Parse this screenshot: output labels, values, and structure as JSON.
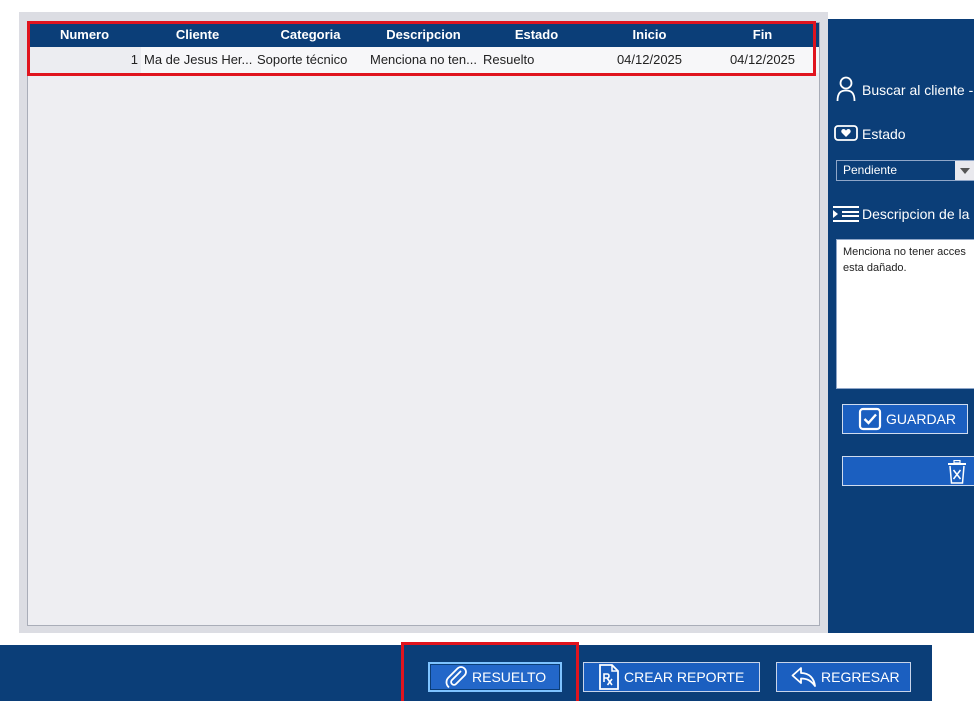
{
  "grid": {
    "columns": [
      "Numero",
      "Cliente",
      "Categoria",
      "Descripcion",
      "Estado",
      "Inicio",
      "Fin"
    ],
    "rows": [
      {
        "numero": "1",
        "cliente": "Ma de Jesus Her...",
        "categoria": "Soporte técnico",
        "descripcion": "Menciona no ten...",
        "estado": "Resuelto",
        "inicio": "04/12/2025",
        "fin": "04/12/2025"
      }
    ]
  },
  "side_panel": {
    "buscar_label": "Buscar al cliente -",
    "estado_label": "Estado",
    "estado_value": "Pendiente",
    "descripcion_label": "Descripcion de la",
    "descripcion_text": "Menciona no tener acces\nesta dañado.",
    "guardar_label": "GUARDAR"
  },
  "bottom_bar": {
    "resuelto_label": "RESUELTO",
    "reporte_label": "CREAR REPORTE",
    "regresar_label": "REGRESAR"
  },
  "colors": {
    "navy": "#0b3e78",
    "button_blue": "#1b5fc0",
    "highlight_red": "#e0141e"
  },
  "icons": [
    "user-icon",
    "heart-card-icon",
    "chevron-down-icon",
    "list-indent-icon",
    "checkbox-icon",
    "trash-icon",
    "paperclip-icon",
    "prescription-icon",
    "return-arrow-icon"
  ]
}
